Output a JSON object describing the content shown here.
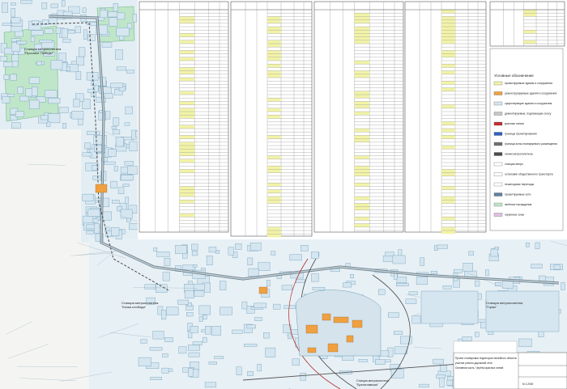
{
  "map": {
    "legend_title": "Условные обозначения",
    "station_top_left": "Станция метрополитена\n\"Проспект Победы\"",
    "station_left_mid": "Станция метрополитена\n\"Козья слобода\"",
    "station_right": "Станция метрополитена\n\"Горки\"",
    "station_bottom": "Станция метрополитена\n\"Братиславская\"",
    "legend_items": [
      "проектируемые здания и сооружения",
      "реконструируемые здания и сооружения",
      "существующие здания и сооружения",
      "демонтируемые, подлежащие сносу",
      "красные линии",
      "границы проектирования",
      "граница зоны планируемого размещения",
      "линии метрополитена",
      "станции метро",
      "остановки общественного транспорта",
      "пешеходные переходы",
      "проектируемые сети",
      "зелёные насаждения",
      "охранные зоны"
    ],
    "colors": {
      "blocks": "#d5e6f0",
      "green_zone": "#bfe6c8",
      "table_highlight": "#f2f3a6",
      "orange_buildings": "#f0a040",
      "metro_line": "#4a4a4a",
      "rail_red": "#b03030"
    },
    "stamp_lines": [
      "Проект планировки территории линейного объекта",
      "участка улично-дорожной сети",
      "Основная часть. Чертёж красных линий",
      "М 1:2000"
    ]
  }
}
